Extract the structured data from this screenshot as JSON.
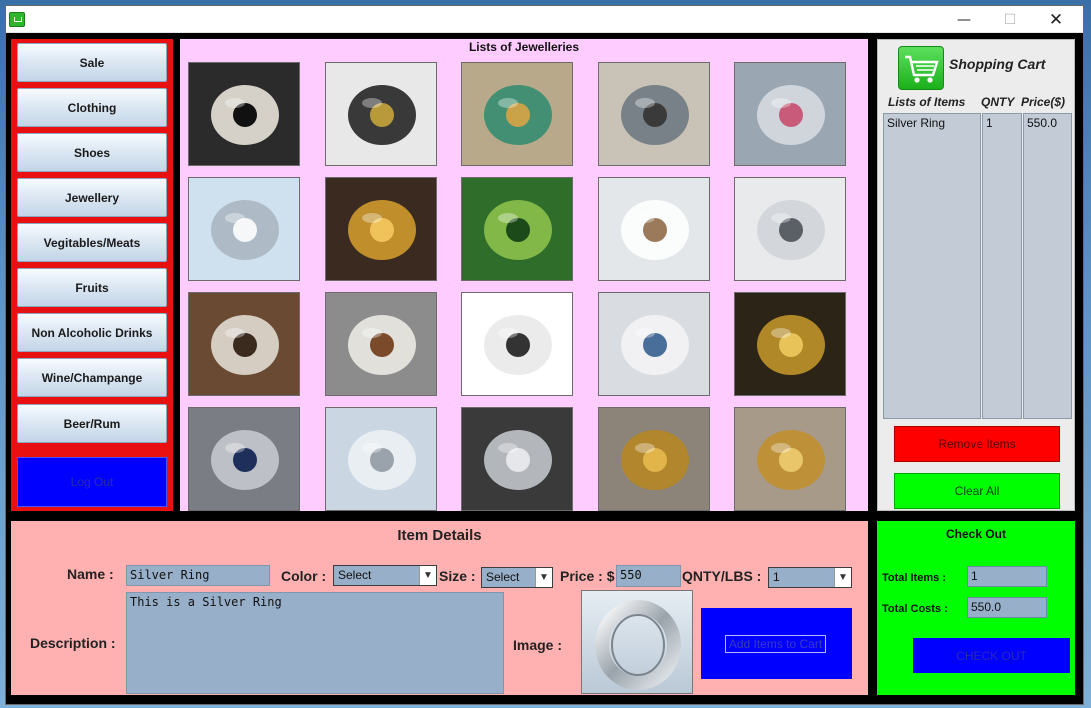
{
  "window": {
    "minimize": "—",
    "maximize": "☐",
    "close": "✕"
  },
  "categories": [
    "Sale",
    "Clothing",
    "Shoes",
    "Jewellery",
    "Vegitables/Meats",
    "Fruits",
    "Non Alcoholic Drinks",
    "Wine/Champange",
    "Beer/Rum"
  ],
  "logout_label": "Log Out",
  "grid": {
    "title": "Lists of Jewelleries",
    "items": [
      "pearl-necklace",
      "black-drop-earrings",
      "gemstone-bracelet",
      "pendant-necklace",
      "gem-rings-row",
      "silver-rings-set",
      "gold-necklace",
      "green-gem-necklace",
      "white-watch",
      "crystal-gem",
      "brown-strap-watch",
      "brown-watch-reflection",
      "smart-ring",
      "blue-gem-necklace",
      "gold-coin-ring",
      "steel-watch",
      "silver-ring",
      "steel-watch-2",
      "gold-earrings",
      "gold-hoop-earrings"
    ]
  },
  "cart": {
    "title": "Shopping Cart",
    "headers": {
      "item": "Lists of Items",
      "qty": "QNTY",
      "price": "Price($)"
    },
    "rows": [
      {
        "item": "Silver Ring",
        "qty": "1",
        "price": "550.0"
      }
    ],
    "remove_label": "Remove Items",
    "clear_label": "Clear All"
  },
  "details": {
    "title": "Item Details",
    "name_label": "Name :",
    "name_value": "Silver Ring",
    "color_label": "Color :",
    "color_value": "Select",
    "size_label": "Size :",
    "size_value": "Select",
    "price_label": "Price : $",
    "price_value": "550",
    "qty_label": "QNTY/LBS :",
    "qty_value": "1",
    "description_label": "Description :",
    "description_value": "This is a Silver Ring",
    "image_label": "Image :",
    "add_label": "Add Items to Cart"
  },
  "checkout": {
    "title": "Check Out",
    "total_items_label": "Total Items :",
    "total_items_value": "1",
    "total_costs_label": "Total Costs :",
    "total_costs_value": "550.0",
    "button_label": "CHECK OUT"
  },
  "colors": {
    "category_border": "#e81010",
    "grid_bg": "#ffccff",
    "details_bg": "#ffb0b0",
    "checkout_bg": "#00ff00",
    "blue_button": "#0000ff",
    "remove_button": "#ff0000",
    "clear_button": "#00ff00"
  }
}
